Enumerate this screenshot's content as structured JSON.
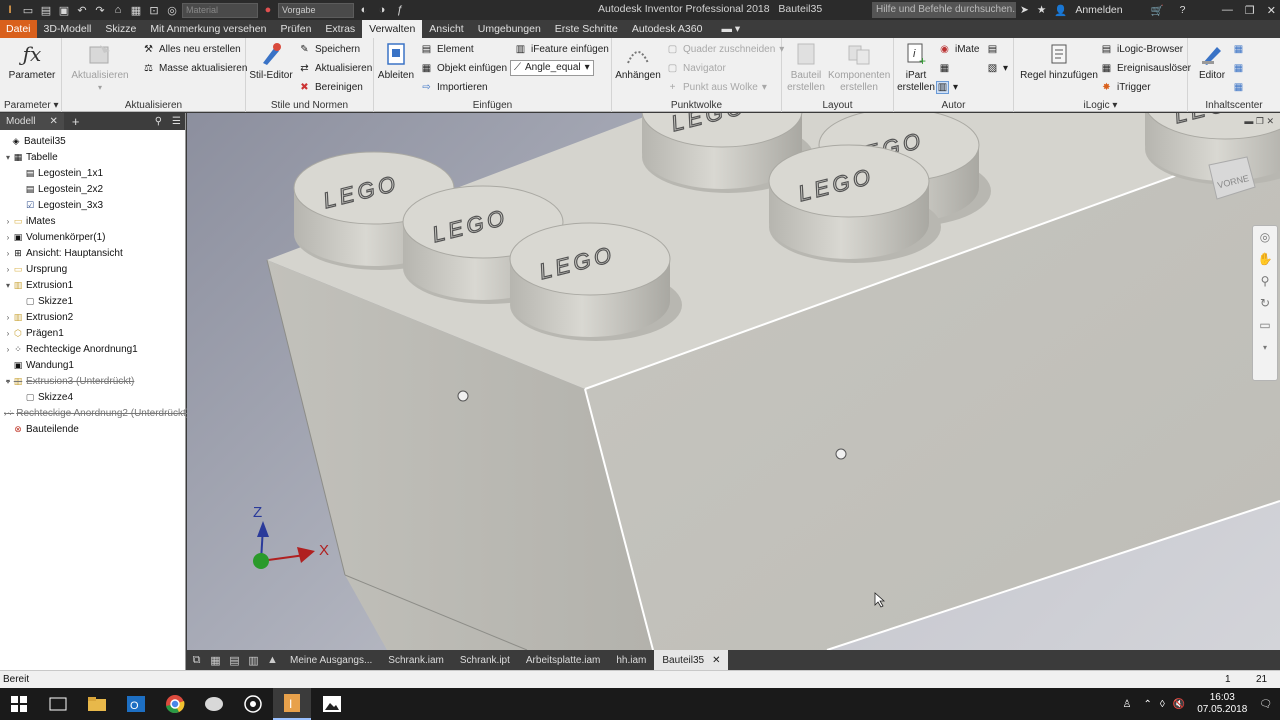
{
  "titlebar": {
    "app_title": "Autodesk Inventor Professional 2018",
    "document": "Bauteil35",
    "material_combo": "Material",
    "appearance_combo": "Vorgabe",
    "search_placeholder": "Hilfe und Befehle durchsuchen...",
    "signin": "Anmelden"
  },
  "tabs": [
    "3D-Modell",
    "Skizze",
    "Mit Anmerkung versehen",
    "Prüfen",
    "Extras",
    "Verwalten",
    "Ansicht",
    "Umgebungen",
    "Erste Schritte",
    "Autodesk A360"
  ],
  "file_tab": "Datei",
  "active_tab": "Verwalten",
  "ribbon": {
    "parameter": {
      "button": "Parameter",
      "title": "Parameter"
    },
    "update": {
      "title": "Aktualisieren",
      "update_btn": "Aktualisieren",
      "rebuild_all": "Alles neu erstellen",
      "update_mass": "Masse aktualisieren"
    },
    "styles": {
      "title": "Stile und Normen",
      "style_editor": "Stil-Editor",
      "save": "Speichern",
      "update": "Aktualisieren",
      "purge": "Bereinigen"
    },
    "insert": {
      "title": "Einfügen",
      "derive": "Ableiten",
      "element": "Element",
      "insert_object": "Objekt einfügen",
      "import": "Importieren",
      "ifeature": "iFeature einfügen",
      "angle_combo": "Angle_equal"
    },
    "pointcloud": {
      "title": "Punktwolke",
      "attach": "Anhängen",
      "crop_box": "Quader zuschneiden",
      "navigator": "Navigator",
      "point_from_cloud": "Punkt aus Wolke"
    },
    "layout": {
      "title": "Layout",
      "create_part": "Bauteil erstellen",
      "create_components": "Komponenten erstellen"
    },
    "author": {
      "title": "Autor",
      "ipart": "iPart erstellen",
      "imate": "iMate"
    },
    "ilogic": {
      "title": "iLogic",
      "add_rule": "Regel hinzufügen",
      "browser": "iLogic-Browser",
      "event_trigger": "Ereignisauslöser",
      "itrigger": "iTrigger"
    },
    "content_center": {
      "title": "Inhaltscenter",
      "editor": "Editor"
    }
  },
  "browser": {
    "tab_label": "Modell",
    "tree": [
      {
        "label": "Bauteil35",
        "level": 0,
        "exp": "",
        "icon": "part-icon",
        "sup": false
      },
      {
        "label": "Tabelle",
        "level": 1,
        "exp": "v",
        "icon": "table-icon",
        "sup": false
      },
      {
        "label": "Legostein_1x1",
        "level": 2,
        "exp": "",
        "icon": "member-icon",
        "sup": false
      },
      {
        "label": "Legostein_2x2",
        "level": 2,
        "exp": "",
        "icon": "member-icon",
        "sup": false
      },
      {
        "label": "Legostein_3x3",
        "level": 2,
        "exp": "",
        "icon": "checked-member-icon",
        "sup": false
      },
      {
        "label": "iMates",
        "level": 1,
        "exp": ">",
        "icon": "folder-icon",
        "sup": false
      },
      {
        "label": "Volumenkörper(1)",
        "level": 1,
        "exp": ">",
        "icon": "solid-icon",
        "sup": false
      },
      {
        "label": "Ansicht: Hauptansicht",
        "level": 1,
        "exp": ">",
        "icon": "view-icon",
        "sup": false
      },
      {
        "label": "Ursprung",
        "level": 1,
        "exp": ">",
        "icon": "folder-icon",
        "sup": false
      },
      {
        "label": "Extrusion1",
        "level": 1,
        "exp": "v",
        "icon": "extrude-icon",
        "sup": false
      },
      {
        "label": "Skizze1",
        "level": 2,
        "exp": "",
        "icon": "sketch-icon",
        "sup": false
      },
      {
        "label": "Extrusion2",
        "level": 1,
        "exp": ">",
        "icon": "extrude-icon",
        "sup": false
      },
      {
        "label": "Prägen1",
        "level": 1,
        "exp": ">",
        "icon": "emboss-icon",
        "sup": false
      },
      {
        "label": "Rechteckige Anordnung1",
        "level": 1,
        "exp": ">",
        "icon": "pattern-icon",
        "sup": false
      },
      {
        "label": "Wandung1",
        "level": 1,
        "exp": "",
        "icon": "shell-icon",
        "sup": false
      },
      {
        "label": "Extrusion3 (Unterdrückt)",
        "level": 1,
        "exp": "v",
        "icon": "extrude-icon",
        "sup": true
      },
      {
        "label": "Skizze4",
        "level": 2,
        "exp": "",
        "icon": "sketch-icon",
        "sup": false
      },
      {
        "label": "Rechteckige Anordnung2 (Unterdrückt)",
        "level": 1,
        "exp": ">",
        "icon": "pattern-icon",
        "sup": true
      },
      {
        "label": "Bauteilende",
        "level": 1,
        "exp": "",
        "icon": "end-of-part-icon",
        "sup": false
      }
    ]
  },
  "viewport": {
    "viewcube_label": "VORNE",
    "stud_text": "LEGO",
    "axis_x": "X",
    "axis_z": "Z"
  },
  "doc_tabs": [
    "Meine Ausgangs...",
    "Schrank.iam",
    "Schrank.ipt",
    "Arbeitsplatte.iam",
    "hh.iam"
  ],
  "active_doc_tab": "Bauteil35",
  "status": {
    "text": "Bereit",
    "num1": "1",
    "num2": "21"
  },
  "taskbar": {
    "time": "16:03",
    "date": "07.05.2018"
  },
  "colors": {
    "file_tab": "#d9601c",
    "ribbon_bg": "#f0f0f0",
    "titlebar_bg": "#2b2b2b"
  }
}
